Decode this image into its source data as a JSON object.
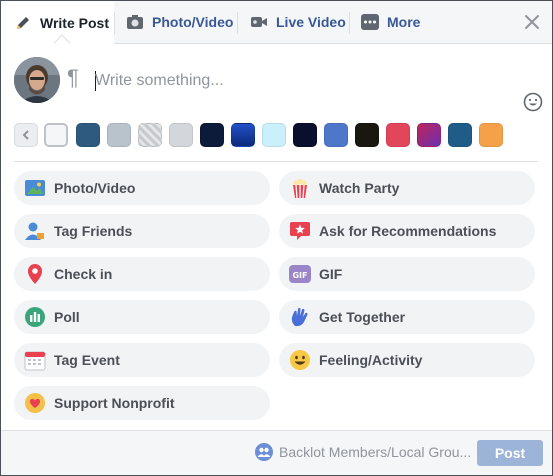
{
  "tabs": {
    "write_post": "Write Post",
    "photo_video": "Photo/Video",
    "live_video": "Live Video",
    "more": "More"
  },
  "composer": {
    "placeholder": "Write something...",
    "value": ""
  },
  "icons": {
    "tab_write": "pencil-icon",
    "tab_photo": "camera-icon",
    "tab_live": "video-camera-icon",
    "tab_more": "ellipsis-icon",
    "close": "close-icon",
    "paragraph": "pilcrow-icon",
    "emoji": "smiley-icon",
    "audience": "group-icon"
  },
  "backgrounds": {
    "colors": [
      "#ebedf0",
      "#f5f6f7",
      "#2d5a7e",
      "#b9c3cc",
      "#cfd2d6",
      "#d3d6da",
      "#0c1b3a",
      "#1e3ea8",
      "#c9f0fb",
      "#0a0f2e",
      "#4e76c9",
      "#1a1710",
      "#e2465a",
      "#7a2fa0",
      "#205c88",
      "#f5a14a"
    ]
  },
  "actions": {
    "left": [
      {
        "label": "Photo/Video",
        "icon": "photo-icon"
      },
      {
        "label": "Tag Friends",
        "icon": "tag-friends-icon"
      },
      {
        "label": "Check in",
        "icon": "location-pin-icon"
      },
      {
        "label": "Poll",
        "icon": "poll-icon"
      },
      {
        "label": "Tag Event",
        "icon": "calendar-icon"
      },
      {
        "label": "Support Nonprofit",
        "icon": "heart-hand-icon"
      }
    ],
    "right": [
      {
        "label": "Watch Party",
        "icon": "popcorn-icon"
      },
      {
        "label": "Ask for Recommendations",
        "icon": "star-pin-icon"
      },
      {
        "label": "GIF",
        "icon": "gif-icon"
      },
      {
        "label": "Get Together",
        "icon": "waving-hand-icon"
      },
      {
        "label": "Feeling/Activity",
        "icon": "smiley-face-icon"
      }
    ]
  },
  "footer": {
    "audience": "Backlot Members/Local Grou...",
    "post_label": "Post"
  },
  "colors": {
    "accent": "#385898",
    "post_disabled": "#9cb4d8",
    "pill_bg": "#f2f3f5"
  }
}
